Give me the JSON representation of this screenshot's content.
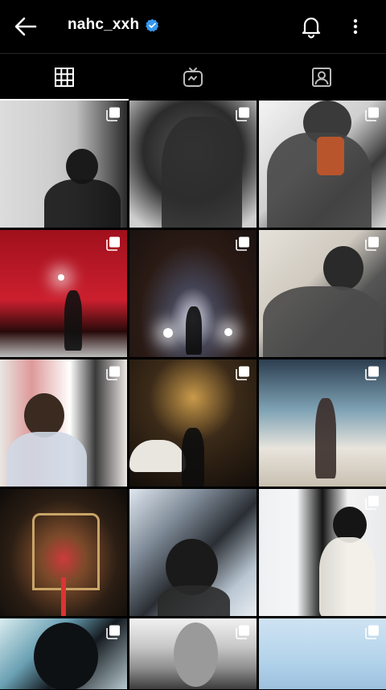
{
  "header": {
    "username": "nahc_xxh",
    "back_icon": "arrow-left-icon",
    "verified_icon": "verified-badge-icon",
    "notifications_icon": "bell-icon",
    "more_icon": "more-vertical-icon",
    "verified_color": "#3797f0"
  },
  "tabs": [
    {
      "name": "posts-grid",
      "icon": "grid-icon",
      "active": true
    },
    {
      "name": "igtv",
      "icon": "tv-icon",
      "active": false
    },
    {
      "name": "tagged",
      "icon": "tagged-person-icon",
      "active": false
    }
  ],
  "posts": [
    {
      "id": 1,
      "multi": true,
      "icon": "multiple-photos-icon"
    },
    {
      "id": 2,
      "multi": true,
      "icon": "multiple-photos-icon"
    },
    {
      "id": 3,
      "multi": true,
      "icon": "multiple-photos-icon"
    },
    {
      "id": 4,
      "multi": true,
      "icon": "multiple-photos-icon"
    },
    {
      "id": 5,
      "multi": true,
      "icon": "multiple-photos-icon"
    },
    {
      "id": 6,
      "multi": true,
      "icon": "multiple-photos-icon"
    },
    {
      "id": 7,
      "multi": true,
      "icon": "multiple-photos-icon"
    },
    {
      "id": 8,
      "multi": true,
      "icon": "multiple-photos-icon"
    },
    {
      "id": 9,
      "multi": true,
      "icon": "multiple-photos-icon"
    },
    {
      "id": 10,
      "multi": false,
      "icon": ""
    },
    {
      "id": 11,
      "multi": false,
      "icon": ""
    },
    {
      "id": 12,
      "multi": true,
      "icon": "multiple-photos-icon"
    },
    {
      "id": 13,
      "multi": true,
      "icon": "multiple-photos-icon"
    },
    {
      "id": 14,
      "multi": true,
      "icon": "multiple-photos-icon"
    },
    {
      "id": 15,
      "multi": true,
      "icon": "multiple-photos-icon"
    }
  ]
}
